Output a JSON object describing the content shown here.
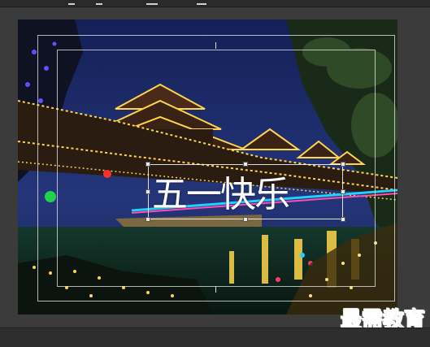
{
  "editor": {
    "overlay_text": "五一快乐",
    "watermark": "最需教育"
  },
  "toolbar": {
    "icons": [
      "toolbar-tool-icon-1",
      "toolbar-tool-icon-2",
      "toolbar-tool-icon-3",
      "toolbar-tool-icon-4"
    ]
  },
  "colors": {
    "sky": "#1c2a63",
    "lights": "#ffd54a",
    "water": "#0f2a22",
    "watermark": "#1e3fd8"
  }
}
